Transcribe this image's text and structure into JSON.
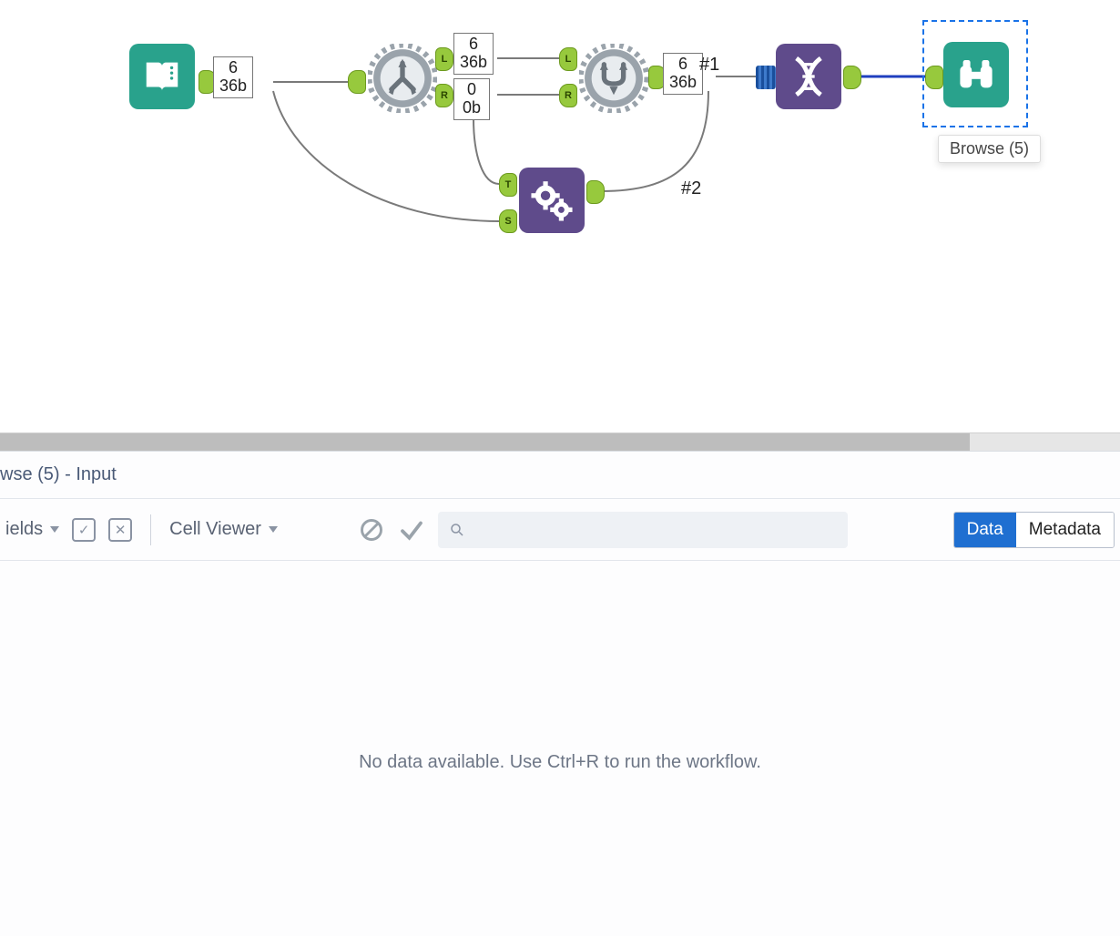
{
  "canvas": {
    "tags": {
      "input_out": {
        "line1": "6",
        "line2": "36b"
      },
      "split_top": {
        "line1": "6",
        "line2": "36b"
      },
      "split_bot": {
        "line1": "0",
        "line2": "0b"
      },
      "union_out": {
        "line1": "6",
        "line2": "36b"
      }
    },
    "anchor_labels": {
      "L": "L",
      "R": "R",
      "T": "T",
      "S": "S"
    },
    "hash1": "#1",
    "hash2": "#2",
    "selected_caption": "Browse (5)"
  },
  "results": {
    "title": "wse (5) - Input",
    "fields_dropdown": "ields",
    "cell_viewer": "Cell Viewer",
    "data_tab": "Data",
    "metadata_tab": "Metadata",
    "empty": "No data available. Use Ctrl+R to run the workflow."
  }
}
